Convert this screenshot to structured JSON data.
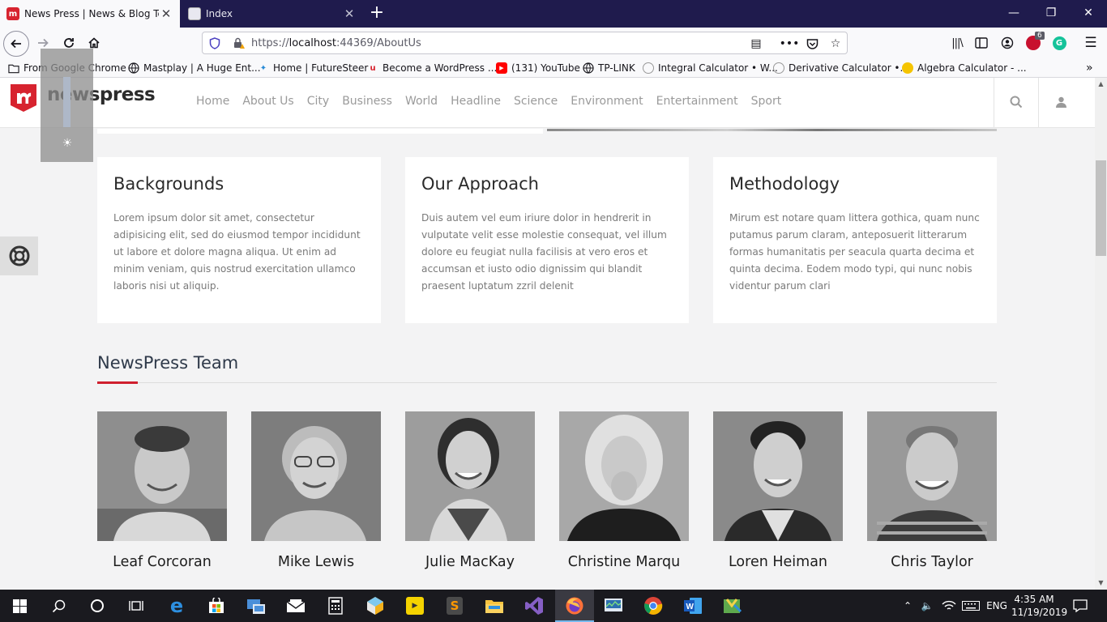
{
  "browser": {
    "tabs": [
      {
        "title": "News Press | News & Blog Temp",
        "active": true,
        "icon": "newspress-favicon"
      },
      {
        "title": "Index",
        "active": false,
        "icon": "document-favicon"
      }
    ],
    "url_prefix": "https://",
    "url_host": "localhost",
    "url_path": ":44369/AboutUs",
    "addon_badge": "6",
    "bookmarks": [
      "From Google Chrome",
      "Mastplay | A Huge Ent...",
      "Home | FutureSteer",
      "Become a WordPress ...",
      "(131) YouTube",
      "TP-LINK",
      "Integral Calculator • W...",
      "Derivative Calculator •...",
      "Algebra Calculator - ..."
    ]
  },
  "site": {
    "logo_text": "newspress",
    "brand_color": "#d7232f",
    "nav": [
      "Home",
      "About Us",
      "City",
      "Business",
      "World",
      "Headline",
      "Science",
      "Environment",
      "Entertainment",
      "Sport"
    ]
  },
  "features": [
    {
      "title": "Backgrounds",
      "text": "Lorem ipsum dolor sit amet, consectetur adipisicing elit, sed do eiusmod tempor incididunt ut labore et dolore magna aliqua. Ut enim ad minim veniam, quis nostrud exercitation ullamco laboris nisi ut aliquip."
    },
    {
      "title": "Our Approach",
      "text": "Duis autem vel eum iriure dolor in hendrerit in vulputate velit esse molestie consequat, vel illum dolore eu feugiat nulla facilisis at vero eros et accumsan et iusto odio dignissim qui blandit praesent luptatum zzril delenit"
    },
    {
      "title": "Methodology",
      "text": "Mirum est notare quam littera gothica, quam nunc putamus parum claram, anteposuerit litterarum formas humanitatis per seacula quarta decima et quinta decima. Eodem modo typi, qui nunc nobis videntur parum clari"
    }
  ],
  "team": {
    "title": "NewsPress Team",
    "accent_color": "#cf1f2e",
    "members": [
      "Leaf Corcoran",
      "Mike Lewis",
      "Julie MacKay",
      "Christine Marqu",
      "Loren Heiman",
      "Chris Taylor"
    ]
  },
  "taskbar": {
    "apps": [
      "windows-start",
      "search",
      "cortana",
      "task-view",
      "edge",
      "store",
      "remote-desktop",
      "mail",
      "calculator",
      "unity-hub",
      "potplayer",
      "sublime-text",
      "file-explorer",
      "visual-studio",
      "firefox",
      "task-manager",
      "chrome",
      "word",
      "photos"
    ],
    "language": "ENG",
    "time": "4:35 AM",
    "date": "11/19/2019"
  }
}
